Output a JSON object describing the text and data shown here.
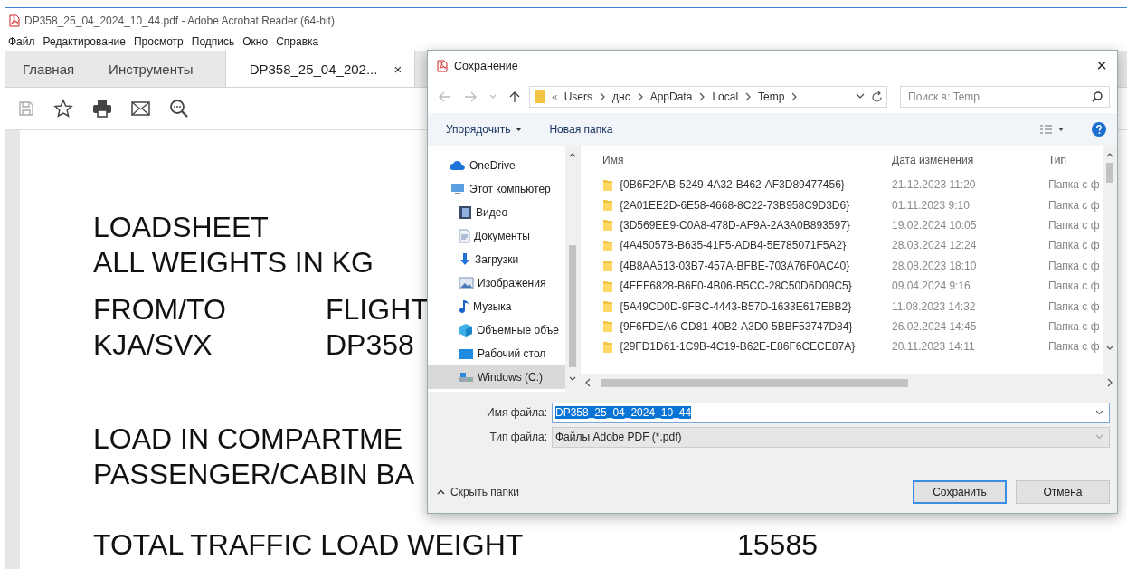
{
  "app": {
    "title": "DP358_25_04_2024_10_44.pdf - Adobe Acrobat Reader (64-bit)",
    "menu": [
      "Файл",
      "Редактирование",
      "Просмотр",
      "Подпись",
      "Окно",
      "Справка"
    ],
    "tabs": [
      {
        "label": "Главная",
        "selected": false,
        "closable": false
      },
      {
        "label": "Инструменты",
        "selected": false,
        "closable": false
      },
      {
        "label": "DP358_25_04_202...",
        "selected": true,
        "closable": true,
        "close": "×"
      }
    ]
  },
  "document": {
    "groups": [
      [
        {
          "kind": "single",
          "cells": [
            "LOADSHEET"
          ]
        },
        {
          "kind": "single",
          "cells": [
            "ALL WEIGHTS IN KG"
          ]
        }
      ],
      [
        {
          "kind": "pair",
          "cells": [
            "FROM/TO",
            "FLIGHT"
          ]
        },
        {
          "kind": "pair",
          "cells": [
            "KJA/SVX",
            "DP358"
          ]
        }
      ],
      [
        {
          "kind": "single",
          "cells": [
            "LOAD IN COMPARTME"
          ]
        },
        {
          "kind": "single",
          "cells": [
            "PASSENGER/CABIN BA"
          ]
        }
      ],
      [
        {
          "kind": "value",
          "cells": [
            "TOTAL TRAFFIC LOAD WEIGHT",
            "15585"
          ]
        }
      ]
    ]
  },
  "dialog": {
    "title": "Сохранение",
    "close": "×",
    "path_overflow": "«",
    "path": [
      "Users",
      "днс",
      "AppData",
      "Local",
      "Temp"
    ],
    "search": {
      "placeholder": "Поиск в: Temp"
    },
    "organize": "Упорядочить",
    "new_folder": "Новая папка",
    "sidebar": [
      {
        "label": "OneDrive",
        "kind": "cloud",
        "selected": false
      },
      {
        "label": "Этот компьютер",
        "kind": "computer",
        "selected": false,
        "children": [
          {
            "label": "Видео",
            "kind": "video",
            "selected": false
          },
          {
            "label": "Документы",
            "kind": "documents",
            "selected": false
          },
          {
            "label": "Загрузки",
            "kind": "downloads",
            "selected": false
          },
          {
            "label": "Изображения",
            "kind": "pictures",
            "selected": false
          },
          {
            "label": "Музыка",
            "kind": "music",
            "selected": false
          },
          {
            "label": "Объемные объе",
            "kind": "objects3d",
            "selected": false
          },
          {
            "label": "Рабочий стол",
            "kind": "desktop",
            "selected": false
          },
          {
            "label": "Windows (C:)",
            "kind": "drive",
            "selected": true
          }
        ]
      }
    ],
    "columns": [
      "Имя",
      "Дата изменения",
      "Тип"
    ],
    "rows": [
      {
        "name": "{0B6F2FAB-5249-4A32-B462-AF3D89477456}",
        "date": "21.12.2023 11:20",
        "type": "Папка с ф"
      },
      {
        "name": "{2A01EE2D-6E58-4668-8C22-73B958C9D3D6}",
        "date": "01.11.2023 9:10",
        "type": "Папка с ф"
      },
      {
        "name": "{3D569EE9-C0A8-478D-AF9A-2A3A0B893597}",
        "date": "19.02.2024 10:05",
        "type": "Папка с ф"
      },
      {
        "name": "{4A45057B-B635-41F5-ADB4-5E785071F5A2}",
        "date": "28.03.2024 12:24",
        "type": "Папка с ф"
      },
      {
        "name": "{4B8AA513-03B7-457A-BFBE-703A76F0AC40}",
        "date": "28.08.2023 18:10",
        "type": "Папка с ф"
      },
      {
        "name": "{4FEF6828-B6F0-4B06-B5CC-28C50D6D09C5}",
        "date": "09.04.2024 9:16",
        "type": "Папка с ф"
      },
      {
        "name": "{5A49CD0D-9FBC-4443-B57D-1633E617E8B2}",
        "date": "11.08.2023 14:32",
        "type": "Папка с ф"
      },
      {
        "name": "{9F6FDEA6-CD81-40B2-A3D0-5BBF53747D84}",
        "date": "26.02.2024 14:45",
        "type": "Папка с ф"
      },
      {
        "name": "{29FD1D61-1C9B-4C19-B62E-E86F6CECE87A}",
        "date": "20.11.2023 14:11",
        "type": "Папка с ф"
      }
    ],
    "filename": {
      "label": "Имя файла:",
      "value": "DP358_25_04_2024_10_44",
      "selected": true
    },
    "filetype": {
      "label": "Тип файла:",
      "value": "Файлы Adobe PDF (*.pdf)"
    },
    "hide_folders": "Скрыть папки",
    "buttons": [
      {
        "label": "Сохранить",
        "default": true
      },
      {
        "label": "Отмена",
        "default": false
      }
    ]
  }
}
